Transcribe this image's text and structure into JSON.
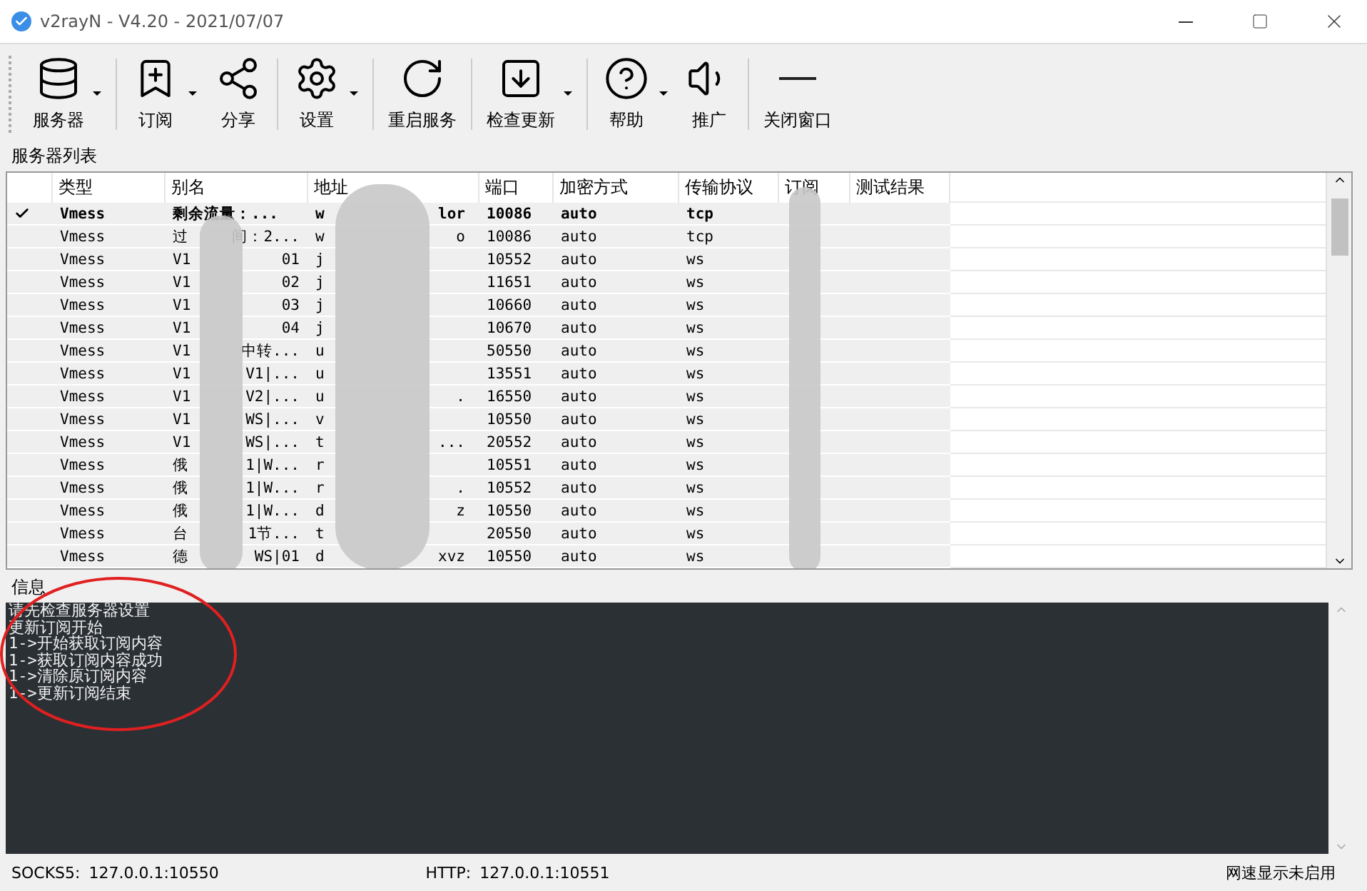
{
  "window": {
    "title": "v2rayN - V4.20 - 2021/07/07"
  },
  "toolbar": [
    {
      "label": "服务器",
      "dropdown": true,
      "separator_after": true
    },
    {
      "label": "订阅",
      "dropdown": true,
      "separator_after": false
    },
    {
      "label": "分享",
      "dropdown": false,
      "separator_after": true
    },
    {
      "label": "设置",
      "dropdown": true,
      "separator_after": true
    },
    {
      "label": "重启服务",
      "dropdown": false,
      "separator_after": true
    },
    {
      "label": "检查更新",
      "dropdown": true,
      "separator_after": true
    },
    {
      "label": "帮助",
      "dropdown": true,
      "separator_after": false
    },
    {
      "label": "推广",
      "dropdown": false,
      "separator_after": true
    },
    {
      "label": "关闭窗口",
      "dropdown": false,
      "separator_after": false
    }
  ],
  "server_list": {
    "title": "服务器列表",
    "columns": [
      "类型",
      "别名",
      "地址",
      "端口",
      "加密方式",
      "传输协议",
      "订阅",
      "测试结果"
    ],
    "rows": [
      {
        "active": true,
        "type": "Vmess",
        "alias": [
          "剩余流量：..."
        ],
        "address": [
          "w",
          "lor"
        ],
        "port": "10086",
        "security": "auto",
        "network": "tcp"
      },
      {
        "active": false,
        "type": "Vmess",
        "alias": [
          "过",
          "间：2..."
        ],
        "address": [
          "w",
          "o"
        ],
        "port": "10086",
        "security": "auto",
        "network": "tcp"
      },
      {
        "active": false,
        "type": "Vmess",
        "alias": [
          "V1",
          "01"
        ],
        "address": [
          "j"
        ],
        "port": "10552",
        "security": "auto",
        "network": "ws"
      },
      {
        "active": false,
        "type": "Vmess",
        "alias": [
          "V1",
          "02"
        ],
        "address": [
          "j"
        ],
        "port": "11651",
        "security": "auto",
        "network": "ws"
      },
      {
        "active": false,
        "type": "Vmess",
        "alias": [
          "V1",
          "03"
        ],
        "address": [
          "j"
        ],
        "port": "10660",
        "security": "auto",
        "network": "ws"
      },
      {
        "active": false,
        "type": "Vmess",
        "alias": [
          "V1",
          "04"
        ],
        "address": [
          "j"
        ],
        "port": "10670",
        "security": "auto",
        "network": "ws"
      },
      {
        "active": false,
        "type": "Vmess",
        "alias": [
          "V1",
          "中转..."
        ],
        "address": [
          "u"
        ],
        "port": "50550",
        "security": "auto",
        "network": "ws"
      },
      {
        "active": false,
        "type": "Vmess",
        "alias": [
          "V1",
          "V1|..."
        ],
        "address": [
          "u"
        ],
        "port": "13551",
        "security": "auto",
        "network": "ws"
      },
      {
        "active": false,
        "type": "Vmess",
        "alias": [
          "V1",
          "V2|..."
        ],
        "address": [
          "u",
          "."
        ],
        "port": "16550",
        "security": "auto",
        "network": "ws"
      },
      {
        "active": false,
        "type": "Vmess",
        "alias": [
          "V1",
          "WS|..."
        ],
        "address": [
          "v"
        ],
        "port": "10550",
        "security": "auto",
        "network": "ws"
      },
      {
        "active": false,
        "type": "Vmess",
        "alias": [
          "V1",
          "WS|..."
        ],
        "address": [
          "t",
          "..."
        ],
        "port": "20552",
        "security": "auto",
        "network": "ws"
      },
      {
        "active": false,
        "type": "Vmess",
        "alias": [
          "俄",
          "1|W..."
        ],
        "address": [
          "r"
        ],
        "port": "10551",
        "security": "auto",
        "network": "ws"
      },
      {
        "active": false,
        "type": "Vmess",
        "alias": [
          "俄",
          "1|W..."
        ],
        "address": [
          "r",
          "."
        ],
        "port": "10552",
        "security": "auto",
        "network": "ws"
      },
      {
        "active": false,
        "type": "Vmess",
        "alias": [
          "俄",
          "1|W..."
        ],
        "address": [
          "d",
          "z"
        ],
        "port": "10550",
        "security": "auto",
        "network": "ws"
      },
      {
        "active": false,
        "type": "Vmess",
        "alias": [
          "台",
          "1节..."
        ],
        "address": [
          "t"
        ],
        "port": "20550",
        "security": "auto",
        "network": "ws"
      },
      {
        "active": false,
        "type": "Vmess",
        "alias": [
          "德",
          "WS|01"
        ],
        "address": [
          "d",
          "xvz"
        ],
        "port": "10550",
        "security": "auto",
        "network": "ws"
      }
    ]
  },
  "info": {
    "title": "信息",
    "lines": [
      "请先检查服务器设置",
      "更新订阅开始",
      "1->开始获取订阅内容",
      "1->获取订阅内容成功",
      "1->清除原订阅内容",
      "1->更新订阅结束"
    ]
  },
  "status_bar": {
    "socks_label": "SOCKS5:",
    "socks_value": "127.0.0.1:10550",
    "http_label": "HTTP:",
    "http_value": "127.0.0.1:10551",
    "speed": "网速显示未启用"
  }
}
